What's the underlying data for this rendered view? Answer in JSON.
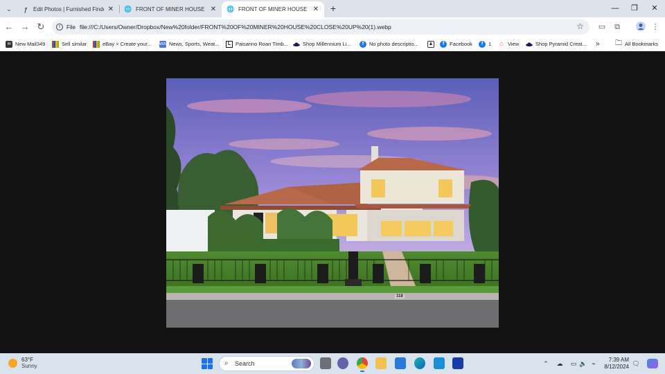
{
  "tabs": [
    {
      "title": "Edit Photos | Furnished Finder",
      "icon": "furnished-finder-icon",
      "active": false
    },
    {
      "title": "FRONT OF MINER HOUSE CLOSE",
      "icon": "globe-icon",
      "active": false
    },
    {
      "title": "FRONT OF MINER HOUSE CLOSE",
      "icon": "globe-icon",
      "active": true
    }
  ],
  "address_bar": {
    "scheme_label": "File",
    "url": "file:///C:/Users/Owner/Dropbox/New%20folder/FRONT%20OF%20MINER%20HOUSE%20CLOSE%20UP%20(1).webp"
  },
  "bookmarks": [
    {
      "label": "New Mail349",
      "icon": "mail-icon"
    },
    {
      "label": "Sell similar",
      "icon": "ebay-icon"
    },
    {
      "label": "eBay > Create your...",
      "icon": "ebay-icon"
    },
    {
      "label": "News, Sports, Weat...",
      "icon": "news-icon"
    },
    {
      "label": "Paisanno Roan Timb...",
      "icon": "bookmark-icon"
    },
    {
      "label": "Shop Millennium Li...",
      "icon": "shop-icon"
    },
    {
      "label": "No photo descriptio...",
      "icon": "facebook-icon"
    },
    {
      "label": "",
      "icon": "figure-icon"
    },
    {
      "label": "Facebook",
      "icon": "facebook-icon"
    },
    {
      "label": "1",
      "icon": "facebook-icon"
    },
    {
      "label": "View",
      "icon": "airbnb-icon"
    },
    {
      "label": "Shop Pyramid Creat...",
      "icon": "shop-icon"
    }
  ],
  "bookmarks_overflow": "»",
  "all_bookmarks_label": "All Bookmarks",
  "house_number": "118",
  "taskbar": {
    "weather_temp": "63°F",
    "weather_condition": "Sunny",
    "search_label": "Search",
    "time": "7:39 AM",
    "date": "8/12/2024"
  }
}
